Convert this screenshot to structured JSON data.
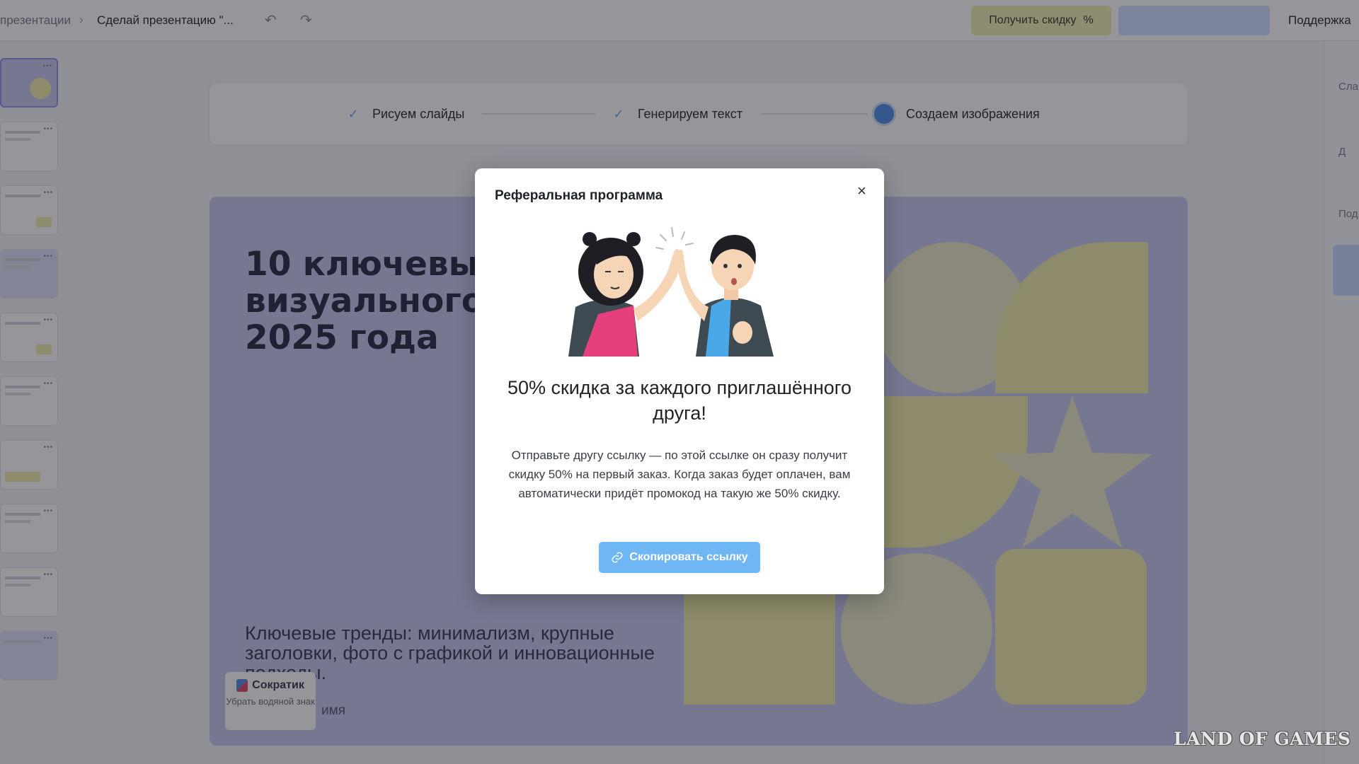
{
  "topbar": {
    "breadcrumb_root": "презентации",
    "breadcrumb_current": "Сделай презентацию \"...",
    "discount_button": "Получить скидку",
    "discount_icon_glyph": "%",
    "download_button": "",
    "support": "Поддержка"
  },
  "right_panel": {
    "labels": [
      "Сла",
      "Д",
      "Под"
    ]
  },
  "progress": {
    "steps": [
      {
        "label": "Рисуем слайды",
        "state": "done"
      },
      {
        "label": "Генерируем текст",
        "state": "done"
      },
      {
        "label": "Создаем изображения",
        "state": "in-progress"
      }
    ]
  },
  "slide": {
    "title": "10 ключевых визуального 2025 года",
    "title_lines": [
      "10 ключевых",
      "визуального",
      "2025 года"
    ],
    "subtitle": "Ключевые тренды: минимализм, крупные заголовки, фото с графикой и инновационные подходы.",
    "author": "имя",
    "watermark_brand": "Сократик",
    "watermark_remove": "Убрать водяной знак"
  },
  "modal": {
    "title": "Реферальная программа",
    "close": "×",
    "heading": "50% скидка за каждого приглашённого друга!",
    "body": "Отправьте другу ссылку — по этой ссылке он сразу получит скидку 50% на первый заказ. Когда заказ будет оплачен, вам автоматически придёт промокод на такую же 50% скидку.",
    "copy_button": "Скопировать ссылку"
  },
  "corner_watermark": "LAND OF GAMES",
  "colors": {
    "accent_blue": "#6fb6f5",
    "slide_background": "#c7cbf0",
    "shape_yellow": "#f0eda9",
    "discount_button": "#f2f0b2"
  },
  "icons": {
    "undo": "undo-icon",
    "redo": "redo-icon",
    "check": "check-icon",
    "close": "close-icon",
    "link": "link-icon"
  }
}
